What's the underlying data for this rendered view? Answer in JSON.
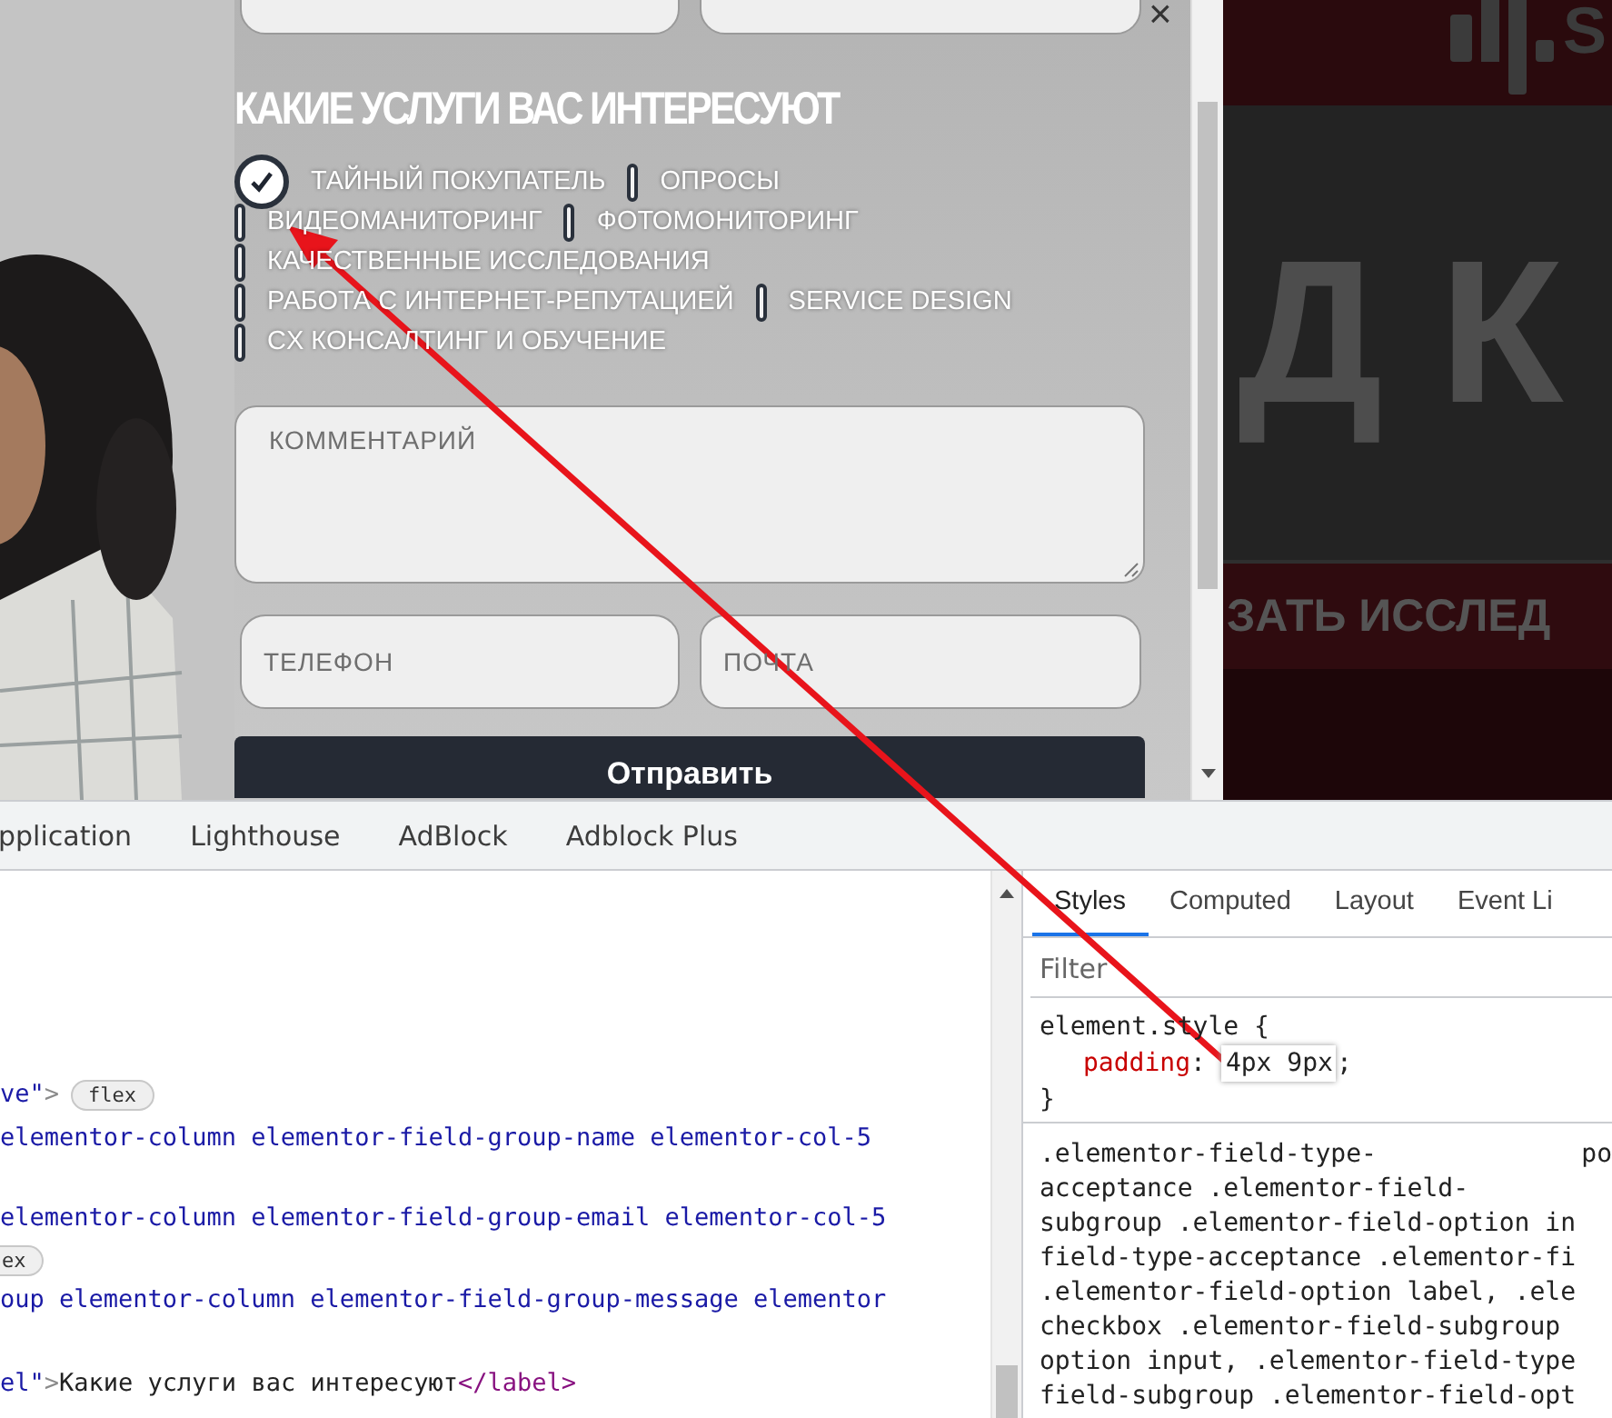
{
  "page": {
    "close": "×",
    "heading": "КАКИЕ УСЛУГИ ВАС ИНТЕРЕСУЮТ",
    "options": [
      {
        "label": "ТАЙНЫЙ ПОКУПАТЕЛЬ",
        "checked": true
      },
      {
        "label": "ОПРОСЫ",
        "checked": false
      },
      {
        "label": "ВИДЕОМАНИТОРИНГ",
        "checked": false
      },
      {
        "label": "ФОТОМОНИТОРИНГ",
        "checked": false
      },
      {
        "label": "КАЧЕСТВЕННЫЕ ИССЛЕДОВАНИЯ",
        "checked": false
      },
      {
        "label": "РАБОТА С ИНТЕРНЕТ-РЕПУТАЦИЕЙ",
        "checked": false
      },
      {
        "label": "SERVICE DESIGN",
        "checked": false
      },
      {
        "label": "CX КОНСАЛТИНГ И ОБУЧЕНИЕ",
        "checked": false
      }
    ],
    "comment": {
      "placeholder": "КОММЕНТАРИЙ"
    },
    "phone": {
      "placeholder": "ТЕЛЕФОН"
    },
    "email": {
      "placeholder": "ПОЧТА"
    },
    "submit": "Отправить",
    "background": {
      "logo_text": "S",
      "headline": "Д К",
      "banner_text": "ЗАТЬ ИССЛЕД"
    }
  },
  "devtools": {
    "tabs": [
      "pplication",
      "Lighthouse",
      "AdBlock",
      "Adblock Plus"
    ],
    "elements": [
      {
        "parts": [
          {
            "text": "ve\"",
            "kind": "value"
          },
          {
            "text": ">",
            "kind": "punct"
          }
        ],
        "badge": "flex"
      },
      {
        "parts": [
          {
            "text": "elementor-column elementor-field-group-name elementor-col-5",
            "kind": "value"
          }
        ]
      },
      {
        "parts": [
          {
            "text": "elementor-column elementor-field-group-email elementor-col-5",
            "kind": "value"
          }
        ]
      },
      {
        "badge": "ex"
      },
      {
        "parts": [
          {
            "text": "oup elementor-column elementor-field-group-message elementor",
            "kind": "value"
          }
        ]
      },
      {
        "parts": [
          {
            "text": "el\"",
            "kind": "value"
          },
          {
            "text": ">",
            "kind": "punct"
          },
          {
            "text": "Какие услуги вас интересуют",
            "kind": "text"
          },
          {
            "text": "</label>",
            "kind": "tag"
          }
        ]
      }
    ],
    "style_tabs": [
      {
        "label": "Styles",
        "selected": true
      },
      {
        "label": "Computed",
        "selected": false
      },
      {
        "label": "Layout",
        "selected": false
      },
      {
        "label": "Event Li",
        "selected": false
      }
    ],
    "filter": {
      "placeholder": "Filter"
    },
    "element_style": {
      "selector": "element.style {",
      "property": "padding",
      "colon": ":",
      "value": "4px 9px",
      "semicolon": ";",
      "close": "}"
    },
    "rule_origin": "po",
    "rule_lines": [
      ".elementor-field-type-",
      "acceptance .elementor-field-",
      "subgroup .elementor-field-option in",
      "field-type-acceptance .elementor-fi",
      ".elementor-field-option label, .ele",
      "checkbox .elementor-field-subgroup",
      "option input, .elementor-field-type",
      "field-subgroup .elementor-field-opt"
    ]
  }
}
